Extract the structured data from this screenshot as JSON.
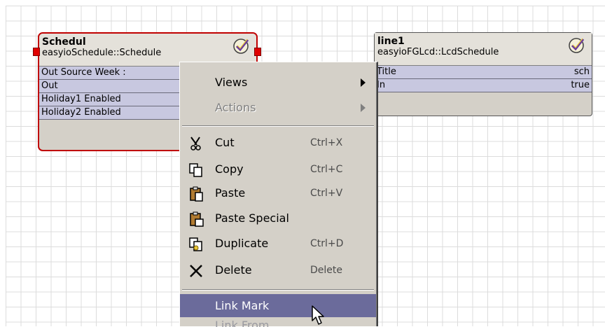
{
  "colors": {
    "menu_bg": "#d4d0c8",
    "highlight": "#6b6b9b",
    "selected_border": "#c00000",
    "slot_alt": "#c8c8e0"
  },
  "blocks": {
    "schedule": {
      "name": "Schedul",
      "type": "easyioSchedule::Schedule",
      "icon": "schedule-check-icon",
      "slots": [
        {
          "label": "Out Source   Week :"
        },
        {
          "label": "Out"
        },
        {
          "label": "Holiday1 Enabled"
        },
        {
          "label": "Holiday2 Enabled"
        }
      ]
    },
    "line1": {
      "name": "line1",
      "type": "easyioFGLcd::LcdSchedule",
      "icon": "schedule-check-icon",
      "slots": [
        {
          "label": "Title",
          "value": "sch"
        },
        {
          "label": "In",
          "value": "true"
        }
      ]
    }
  },
  "context_menu": {
    "views": {
      "label": "Views"
    },
    "actions": {
      "label": "Actions"
    },
    "cut": {
      "label": "Cut",
      "shortcut": "Ctrl+X",
      "icon": "scissors-icon"
    },
    "copy": {
      "label": "Copy",
      "shortcut": "Ctrl+C",
      "icon": "copy-icon"
    },
    "paste": {
      "label": "Paste",
      "shortcut": "Ctrl+V",
      "icon": "clipboard-icon"
    },
    "paste_special": {
      "label": "Paste Special",
      "icon": "clipboard-special-icon"
    },
    "duplicate": {
      "label": "Duplicate",
      "shortcut": "Ctrl+D",
      "icon": "duplicate-icon"
    },
    "delete": {
      "label": "Delete",
      "shortcut": "Delete",
      "icon": "delete-x-icon"
    },
    "link_mark": {
      "label": "Link Mark"
    },
    "link_from": {
      "label": "Link From"
    }
  }
}
